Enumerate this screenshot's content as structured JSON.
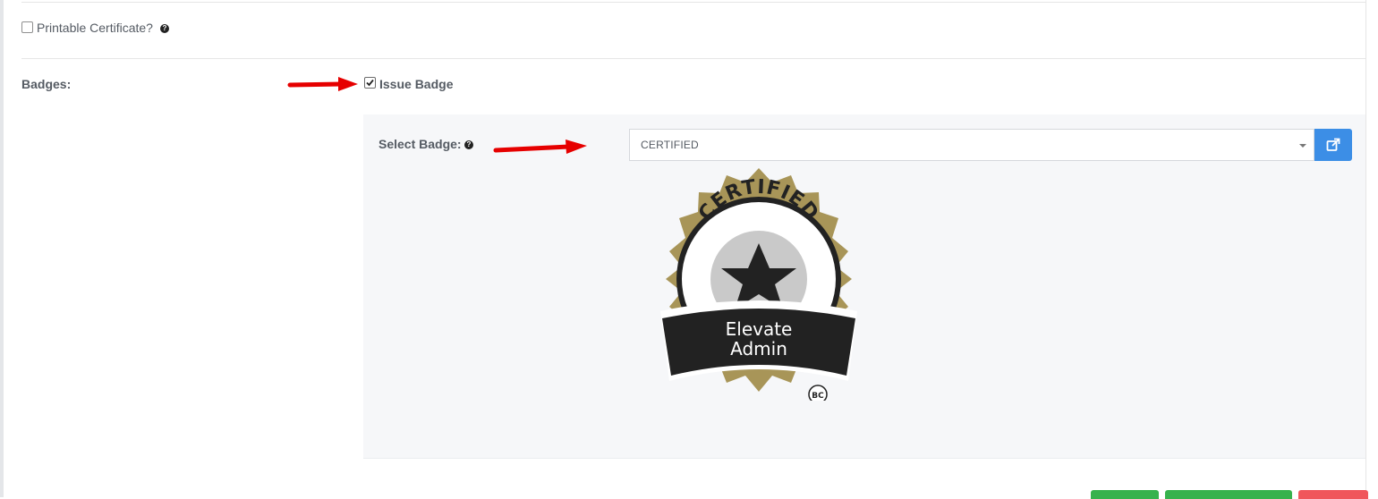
{
  "printable_certificate": {
    "label": "Printable Certificate?",
    "checked": false
  },
  "badges": {
    "section_label": "Badges:",
    "issue_badge": {
      "label": "Issue Badge",
      "checked": true
    },
    "select_badge": {
      "label": "Select Badge:",
      "selected_value": "CERTIFIED"
    },
    "badge_image": {
      "top_text": "CERTIFIED",
      "banner_line1": "Elevate",
      "banner_line2": "Admin",
      "mark": "BC"
    }
  },
  "icons": {
    "help": "question-circle-icon",
    "external_link": "external-link-icon",
    "caret": "caret-down-icon"
  },
  "colors": {
    "accent_blue": "#3c8ee6",
    "badge_gold": "#a89558",
    "badge_dark": "#222222",
    "button_green": "#37b24d",
    "button_red": "#f0565b",
    "annotation_red": "#e60000"
  }
}
